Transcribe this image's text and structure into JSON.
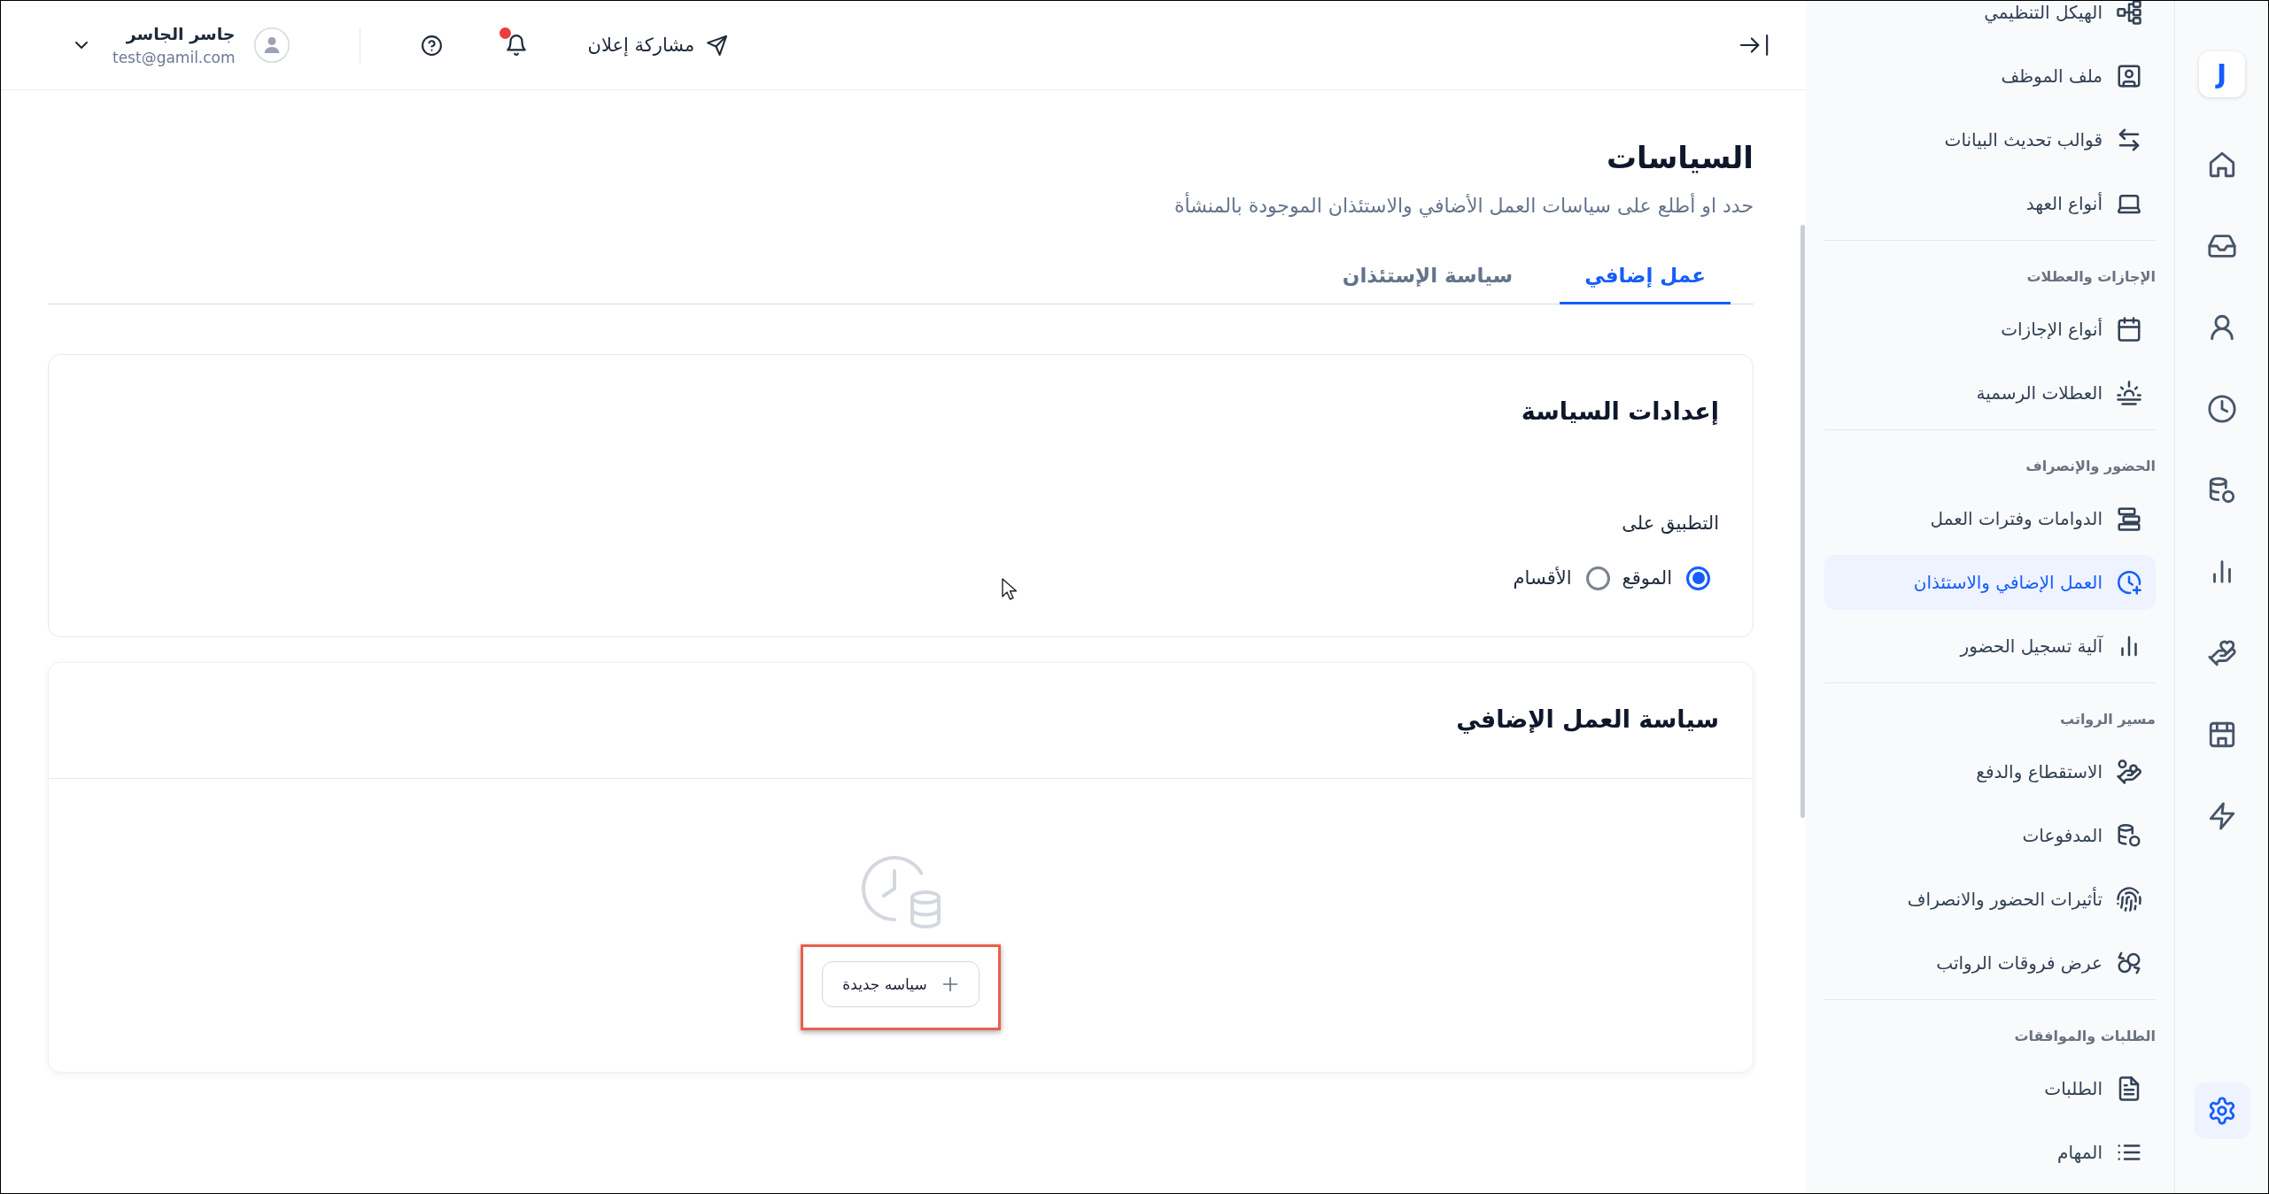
{
  "top_bar": {
    "announcement_button": {
      "label": "مشاركة إعلان"
    },
    "notifications": {
      "unread": true
    },
    "user": {
      "name": "جاسر الجاسر",
      "email": "test@gamil.com"
    }
  },
  "page": {
    "title": "السياسات",
    "subtitle": "حدد او أطلع على سياسات العمل الأضافي والاستئذان الموجودة بالمنشأة"
  },
  "tabs": [
    {
      "label": "عمل إضافي",
      "selected": true
    },
    {
      "label": "سياسة الإستئذان",
      "selected": false
    }
  ],
  "settings_card": {
    "title": "إعدادات السياسة",
    "apply_to": {
      "label": "التطبيق على",
      "options": [
        {
          "label": "الموقع",
          "selected": true
        },
        {
          "label": "الأقسام",
          "selected": false
        }
      ]
    }
  },
  "overtime_card": {
    "title": "سياسة العمل الإضافي",
    "new_policy_button": {
      "label": "سياسه جديدة",
      "highlighted": true
    }
  },
  "sidebar": {
    "groups": [
      {
        "items": [
          {
            "label": "الهيكل التنظيمي",
            "selected": false
          },
          {
            "label": "ملف الموظف",
            "selected": false
          },
          {
            "label": "قوالب تحديث البيانات",
            "selected": false
          },
          {
            "label": "أنواع العهد",
            "selected": false
          }
        ]
      },
      {
        "heading": "الإجازات والعطلات",
        "items": [
          {
            "label": "أنواع الإجازات",
            "selected": false
          },
          {
            "label": "العطلات الرسمية",
            "selected": false
          }
        ]
      },
      {
        "heading": "الحضور والإنصراف",
        "items": [
          {
            "label": "الدوامات وفترات العمل",
            "selected": false
          },
          {
            "label": "العمل الإضافي والاستئذان",
            "selected": true
          },
          {
            "label": "آلية تسجيل الحضور",
            "selected": false
          }
        ]
      },
      {
        "heading": "مسير الرواتب",
        "items": [
          {
            "label": "الاستقطاع والدفع",
            "selected": false
          },
          {
            "label": "المدفوعات",
            "selected": false
          },
          {
            "label": "تأثيرات الحضور والانصراف",
            "selected": false
          },
          {
            "label": "عرض فروقات الرواتب",
            "selected": false
          }
        ]
      },
      {
        "heading": "الطلبات والموافقات",
        "items": [
          {
            "label": "الطلبات",
            "selected": false
          },
          {
            "label": "المهام",
            "selected": false
          }
        ]
      }
    ]
  },
  "rail": {
    "logo": "J",
    "top_items": [
      {
        "selected": false
      },
      {
        "selected": false
      },
      {
        "selected": false
      },
      {
        "selected": false
      },
      {
        "selected": false
      },
      {
        "selected": false
      },
      {
        "selected": false
      },
      {
        "selected": false
      },
      {
        "selected": false
      }
    ],
    "bottom_items": [
      {
        "selected": true
      }
    ]
  }
}
